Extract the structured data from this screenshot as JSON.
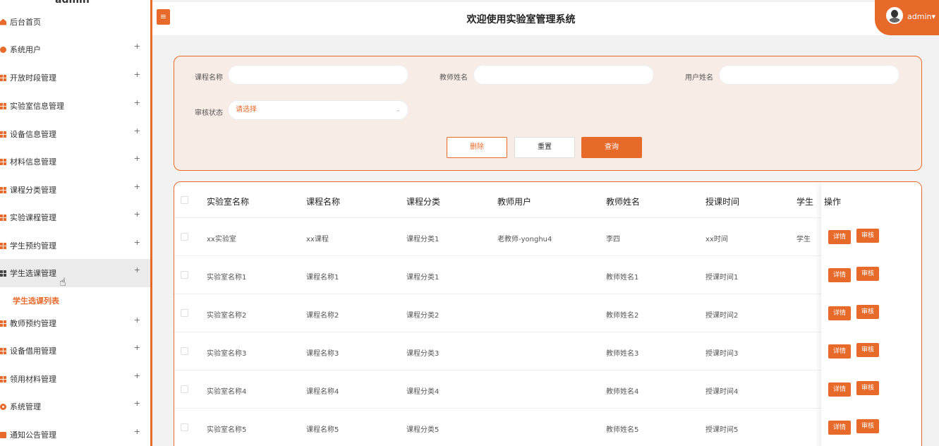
{
  "sidebar": {
    "user": "admin",
    "items": [
      {
        "label": "后台首页",
        "icon": "home-icon",
        "expand": ""
      },
      {
        "label": "系统用户",
        "icon": "user-icon",
        "expand": "+"
      },
      {
        "label": "开放时段管理",
        "icon": "grid-icon",
        "expand": "+"
      },
      {
        "label": "实验室信息管理",
        "icon": "grid-icon",
        "expand": "+"
      },
      {
        "label": "设备信息管理",
        "icon": "grid-icon",
        "expand": "+"
      },
      {
        "label": "材料信息管理",
        "icon": "grid-icon",
        "expand": "+"
      },
      {
        "label": "课程分类管理",
        "icon": "grid-icon",
        "expand": "+"
      },
      {
        "label": "实验课程管理",
        "icon": "grid-icon",
        "expand": "+"
      },
      {
        "label": "学生预约管理",
        "icon": "grid-icon",
        "expand": "+"
      },
      {
        "label": "学生选课管理",
        "icon": "grid-icon",
        "expand": "+"
      },
      {
        "label": "教师预约管理",
        "icon": "grid-icon",
        "expand": "+"
      },
      {
        "label": "设备借用管理",
        "icon": "grid-icon",
        "expand": "+"
      },
      {
        "label": "领用材料管理",
        "icon": "grid-icon",
        "expand": "+"
      },
      {
        "label": "系统管理",
        "icon": "gear-icon",
        "expand": "+"
      },
      {
        "label": "通知公告管理",
        "icon": "notice-icon",
        "expand": "+"
      }
    ],
    "active_sub": "学生选课列表"
  },
  "header": {
    "menu_icon": "≡",
    "title": "欢迎使用实验室管理系统",
    "user": "admin",
    "caret": "▾"
  },
  "search": {
    "course_name_label": "课程名称",
    "teacher_name_label": "教师姓名",
    "username_label": "用户姓名",
    "status_label": "审核状态",
    "status_value": "请选择",
    "chevron": "⌄",
    "delete": "删除",
    "reset": "重置",
    "query": "查询"
  },
  "table": {
    "headers": [
      "实验室名称",
      "课程名称",
      "课程分类",
      "教师用户",
      "教师姓名",
      "授课时间",
      "学生",
      "操作"
    ],
    "rows": [
      [
        "xx实验室",
        "xx课程",
        "课程分类1",
        "老教师-yonghu4",
        "李四",
        "xx时间",
        "学生"
      ],
      [
        "实验室名称1",
        "课程名称1",
        "课程分类1",
        "",
        "教师姓名1",
        "授课时间1",
        ""
      ],
      [
        "实验室名称2",
        "课程名称2",
        "课程分类2",
        "",
        "教师姓名2",
        "授课时间2",
        ""
      ],
      [
        "实验室名称3",
        "课程名称3",
        "课程分类3",
        "",
        "教师姓名3",
        "授课时间3",
        ""
      ],
      [
        "实验室名称4",
        "课程名称4",
        "课程分类4",
        "",
        "教师姓名4",
        "授课时间4",
        ""
      ],
      [
        "实验室名称5",
        "课程名称5",
        "课程分类5",
        "",
        "教师姓名5",
        "授课时间5",
        ""
      ]
    ],
    "detail": "详情",
    "audit": "审核"
  },
  "colors": {
    "accent": "#e86a2a",
    "panel": "#f8ece6"
  }
}
